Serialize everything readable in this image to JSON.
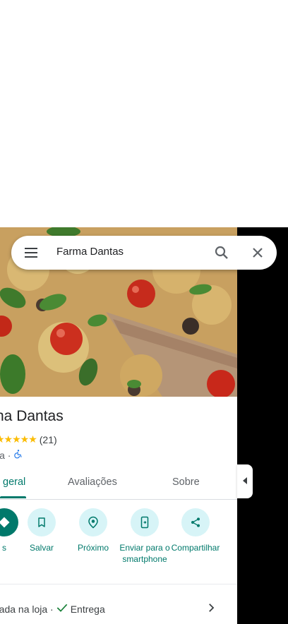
{
  "search": {
    "query": "Farma Dantas",
    "menu_icon": "menu-icon",
    "search_icon": "search-icon",
    "close_icon": "close-icon"
  },
  "place": {
    "title": "na Dantas",
    "rating_stars": "★★★★★",
    "review_count": "(21)",
    "category": "ia ·",
    "accessibility_icon": "wheelchair-icon"
  },
  "tabs": [
    {
      "label": "geral",
      "active": true
    },
    {
      "label": "Avaliações",
      "active": false
    },
    {
      "label": "Sobre",
      "active": false
    }
  ],
  "actions": [
    {
      "label": "s",
      "icon": "directions-icon"
    },
    {
      "label": "Salvar",
      "icon": "bookmark-icon"
    },
    {
      "label": "Próximo",
      "icon": "nearby-icon"
    },
    {
      "label": "Enviar para o smartphone",
      "icon": "send-to-phone-icon"
    },
    {
      "label": "Compartilhar",
      "icon": "share-icon"
    }
  ],
  "services": {
    "instore": "rada na loja ·",
    "delivery": "Entrega"
  },
  "colors": {
    "accent": "#00796b",
    "action_bg": "#d7f4f7",
    "star": "#fbbc04"
  }
}
